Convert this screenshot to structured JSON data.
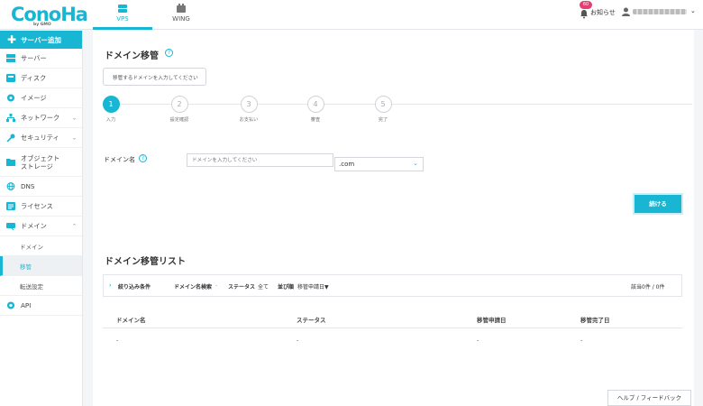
{
  "header": {
    "logo": "ConoHa",
    "logo_sub": "by GMO",
    "tabs": [
      {
        "label": "VPS",
        "active": true
      },
      {
        "label": "WING",
        "active": false
      }
    ],
    "notice_badge": "60",
    "notice_label": "お知らせ"
  },
  "sidebar": {
    "add_server": "サーバー追加",
    "items": [
      {
        "label": "サーバー",
        "icon": "server-icon"
      },
      {
        "label": "ディスク",
        "icon": "disk-icon"
      },
      {
        "label": "イメージ",
        "icon": "image-icon"
      },
      {
        "label": "ネットワーク",
        "icon": "network-icon"
      },
      {
        "label": "セキュリティ",
        "icon": "key-icon"
      },
      {
        "label": "オブジェクト\nストレージ",
        "icon": "folder-icon"
      },
      {
        "label": "DNS",
        "icon": "globe-icon"
      },
      {
        "label": "ライセンス",
        "icon": "license-icon"
      },
      {
        "label": "ドメイン",
        "icon": "domain-icon"
      },
      {
        "label": "API",
        "icon": "api-icon"
      }
    ],
    "domain_sub": [
      "ドメイン",
      "移管",
      "転送設定"
    ]
  },
  "main": {
    "title": "ドメイン移管",
    "hint": "移管するドメインを入力してください",
    "steps": [
      {
        "num": "1",
        "label": "入力"
      },
      {
        "num": "2",
        "label": "設定確認"
      },
      {
        "num": "3",
        "label": "お支払い"
      },
      {
        "num": "4",
        "label": "審査"
      },
      {
        "num": "5",
        "label": "完了"
      }
    ],
    "domain_label": "ドメイン名",
    "domain_placeholder": "ドメインを入力してください",
    "tld_value": ".com",
    "continue_label": "続ける",
    "list_title": "ドメイン移管リスト",
    "filter": {
      "title": "絞り込み条件",
      "search_label": "ドメイン名検索",
      "search_value": "-",
      "status_label": "ステータス",
      "status_value": "全て",
      "sort_label": "並び順",
      "sort_value": "移管申請日▼",
      "count": "該当0件 / 0件"
    },
    "table": {
      "headers": [
        "ドメイン名",
        "ステータス",
        "移管申請日",
        "移管完了日"
      ],
      "row": [
        "-",
        "-",
        "-",
        "-"
      ]
    }
  },
  "footer": {
    "help_label": "ヘルプ / フィードバック"
  },
  "colors": {
    "accent": "#18b6d2",
    "badge": "#e23f72"
  }
}
